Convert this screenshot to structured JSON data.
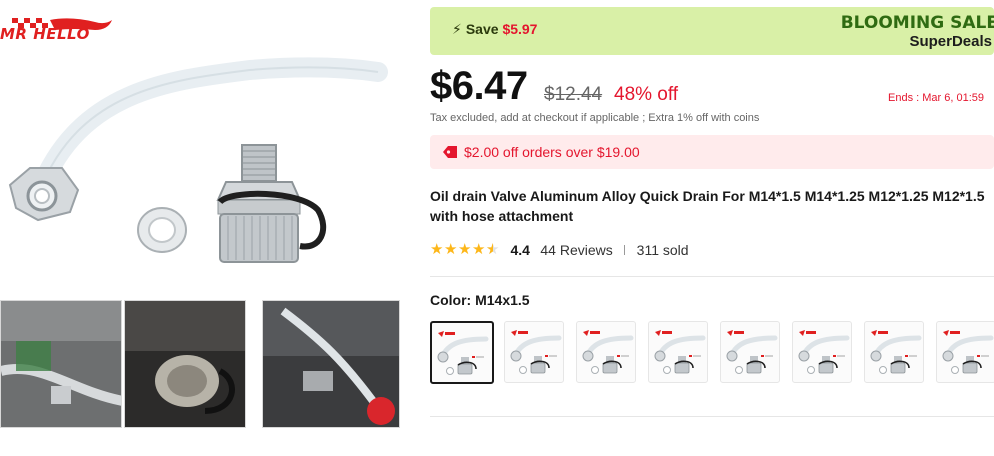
{
  "brand": {
    "logo_text": "MR HELLO"
  },
  "promo": {
    "save_label": "Save",
    "save_amount": "$5.97",
    "sale_title": "BLOOMING SALE",
    "sale_subtitle": "SuperDeals"
  },
  "pricing": {
    "price": "$6.47",
    "original_price": "$12.44",
    "discount": "48% off",
    "ends": "Ends : Mar 6, 01:59",
    "tax_note": "Tax excluded, add at checkout if applicable ; Extra 1% off with coins"
  },
  "coupon": {
    "text": "$2.00 off orders over $19.00",
    "icon": "tag-icon"
  },
  "product": {
    "title": "Oil drain Valve Aluminum Alloy Quick Drain For M14*1.5 M14*1.25 M12*1.25 M12*1.5 with hose attachment"
  },
  "rating": {
    "value": "4.4",
    "score": 4.4,
    "reviews": "44 Reviews",
    "sold": "311 sold"
  },
  "color": {
    "label": "Color: M14x1.5",
    "selected_index": 0,
    "option_count": 8
  },
  "colors": {
    "accent_red": "#e4162e",
    "promo_bg": "#d9f0a7",
    "star": "#fdb71a"
  }
}
